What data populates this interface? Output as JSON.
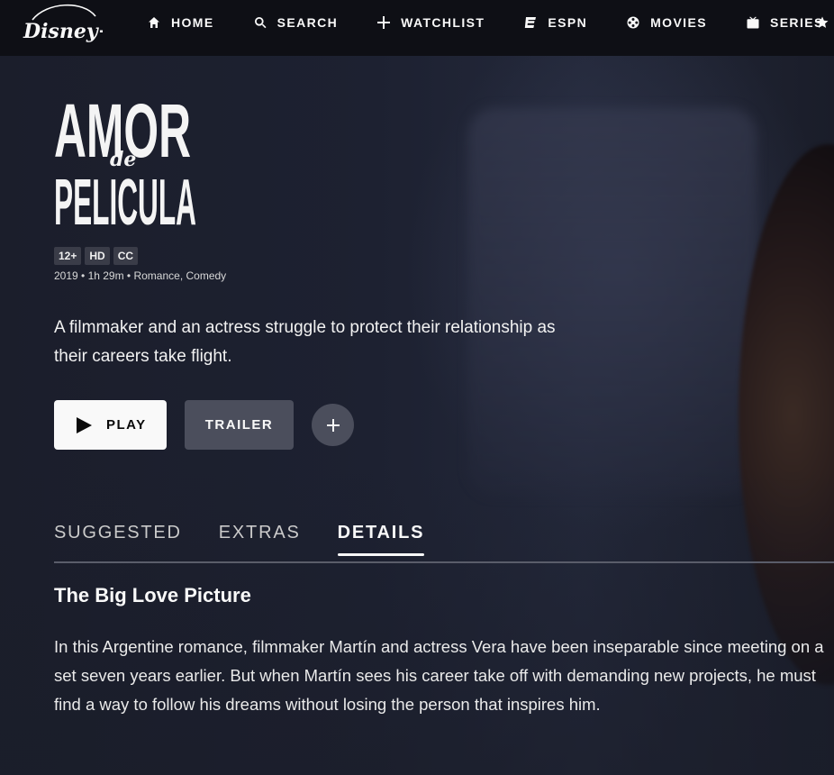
{
  "brand": {
    "logo_text": "Disney+"
  },
  "nav": {
    "items": [
      {
        "label": "HOME",
        "icon": "home-icon"
      },
      {
        "label": "SEARCH",
        "icon": "search-icon"
      },
      {
        "label": "WATCHLIST",
        "icon": "plus-icon"
      },
      {
        "label": "ESPN",
        "icon": "espn-icon"
      },
      {
        "label": "MOVIES",
        "icon": "movies-reel-icon"
      },
      {
        "label": "SERIES",
        "icon": "tv-icon"
      }
    ],
    "overflow_icon": "star-icon"
  },
  "title": {
    "logo_lines": [
      "AMOR",
      "de",
      "PELICULA"
    ]
  },
  "badges": [
    "12+",
    "HD",
    "CC"
  ],
  "meta": "2019 • 1h 29m • Romance, Comedy",
  "description": "A filmmaker and an actress struggle to protect their relationship as their careers take flight.",
  "buttons": {
    "play": "PLAY",
    "trailer": "TRAILER",
    "add_icon": "plus-icon"
  },
  "tabs": [
    {
      "label": "SUGGESTED",
      "active": false
    },
    {
      "label": "EXTRAS",
      "active": false
    },
    {
      "label": "DETAILS",
      "active": true
    }
  ],
  "details": {
    "title": "The Big Love Picture",
    "text": "In this Argentine romance, filmmaker Martín and actress Vera have been inseparable since meeting on a set seven years earlier. But when Martín sees his career take off with demanding new projects, he must find a way to follow his dreams without losing the person that inspires him."
  },
  "colors": {
    "background": "#1a1d29",
    "nav": "#0e0f15",
    "play_button": "#f9f9f9",
    "secondary_button": "#4b4e5c"
  }
}
